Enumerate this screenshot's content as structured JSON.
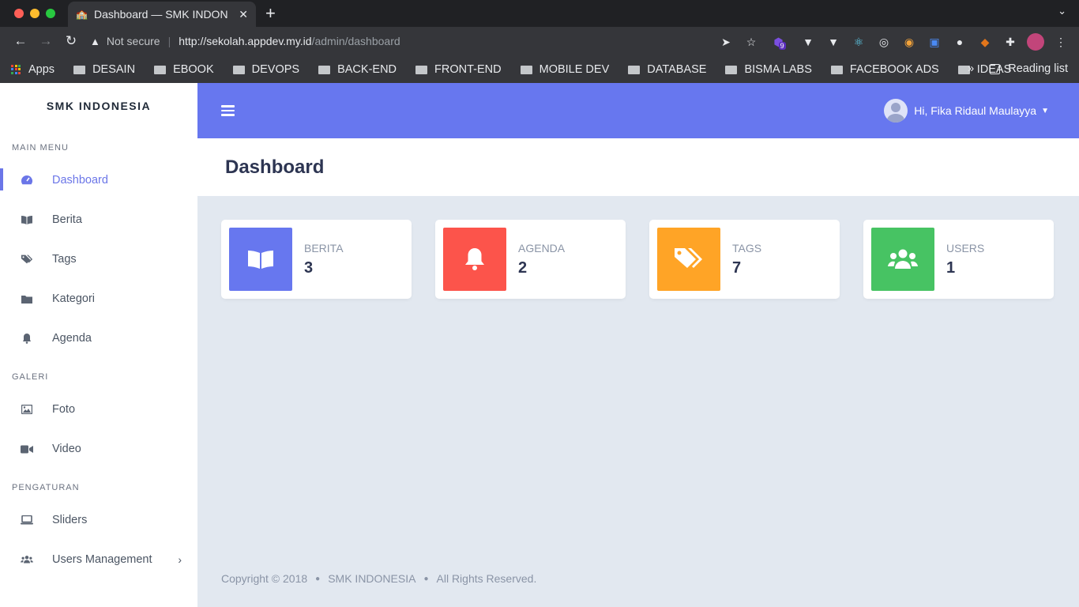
{
  "browser": {
    "tab_title": "Dashboard — SMK INDON",
    "new_tab": "+",
    "security_label": "Not secure",
    "url_host": "http://sekolah.appdev.my.id",
    "url_path": "/admin/dashboard",
    "ext_badge": "9",
    "bookmarks": [
      "Apps",
      "DESAIN",
      "EBOOK",
      "DEVOPS",
      "BACK-END",
      "FRONT-END",
      "MOBILE DEV",
      "DATABASE",
      "BISMA LABS",
      "FACEBOOK ADS",
      "IDEAS"
    ],
    "more": "»",
    "reading_list": "Reading list"
  },
  "sidebar": {
    "brand": "SMK INDONESIA",
    "sections": [
      {
        "heading": "MAIN MENU",
        "items": [
          "Dashboard",
          "Berita",
          "Tags",
          "Kategori",
          "Agenda"
        ]
      },
      {
        "heading": "GALERI",
        "items": [
          "Foto",
          "Video"
        ]
      },
      {
        "heading": "PENGATURAN",
        "items": [
          "Sliders",
          "Users Management"
        ]
      }
    ]
  },
  "topbar": {
    "greeting": "Hi, Fika Ridaul Maulayya"
  },
  "page": {
    "title": "Dashboard"
  },
  "cards": [
    {
      "label": "BERITA",
      "value": "3",
      "color": "#6777ef",
      "icon": "book-open-icon"
    },
    {
      "label": "AGENDA",
      "value": "2",
      "color": "#fc544b",
      "icon": "bell-icon"
    },
    {
      "label": "TAGS",
      "value": "7",
      "color": "#ffa426",
      "icon": "tags-icon"
    },
    {
      "label": "USERS",
      "value": "1",
      "color": "#47c363",
      "icon": "users-icon"
    }
  ],
  "footer": {
    "copyright": "Copyright © 2018",
    "brand": "SMK INDONESIA",
    "rights": "All Rights Reserved."
  }
}
